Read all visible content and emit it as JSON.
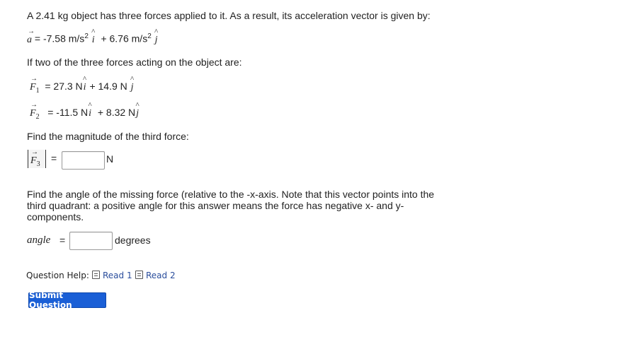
{
  "question": {
    "intro": "A 2.41 kg object has three forces applied to it. As a result, its acceleration vector is given by:",
    "accel": {
      "symbol": "a",
      "eq_x": "= -7.58 m/s",
      "exp": "2",
      "unit_i": "i",
      "eq_y": "+ 6.76 m/s",
      "exp2": "2",
      "unit_j": "j"
    },
    "if_text": "If two of the three forces acting on the object are:",
    "f1": {
      "symbol": "F",
      "sub": "1",
      "expr_a": "= 27.3 N",
      "i": "i",
      "expr_b": "+ 14.9 N",
      "j": "j"
    },
    "f2": {
      "symbol": "F",
      "sub": "2",
      "expr_a": "= -11.5 N",
      "i": "i",
      "expr_b": "+ 8.32 N",
      "j": "j"
    },
    "find_mag": "Find the magnitude of the third force:",
    "f3": {
      "symbol": "F",
      "sub": "3",
      "equals": "=",
      "unit": "N",
      "value": ""
    },
    "find_angle_1": "Find the angle of the missing force (relative to the -x-axis. Note that this vector points into the",
    "find_angle_2": "third quadrant: a positive angle for this answer means the force has negative x- and y-",
    "find_angle_3": "components.",
    "angle": {
      "label": "angle",
      "equals": "=",
      "unit": "degrees",
      "value": ""
    }
  },
  "help": {
    "label": "Question Help:",
    "links": [
      "Read 1",
      "Read 2"
    ]
  },
  "submit_label": "Submit Question",
  "icons": {
    "read": "document-icon"
  },
  "colors": {
    "button": "#1a5fd6",
    "link": "#2a4d9c"
  }
}
